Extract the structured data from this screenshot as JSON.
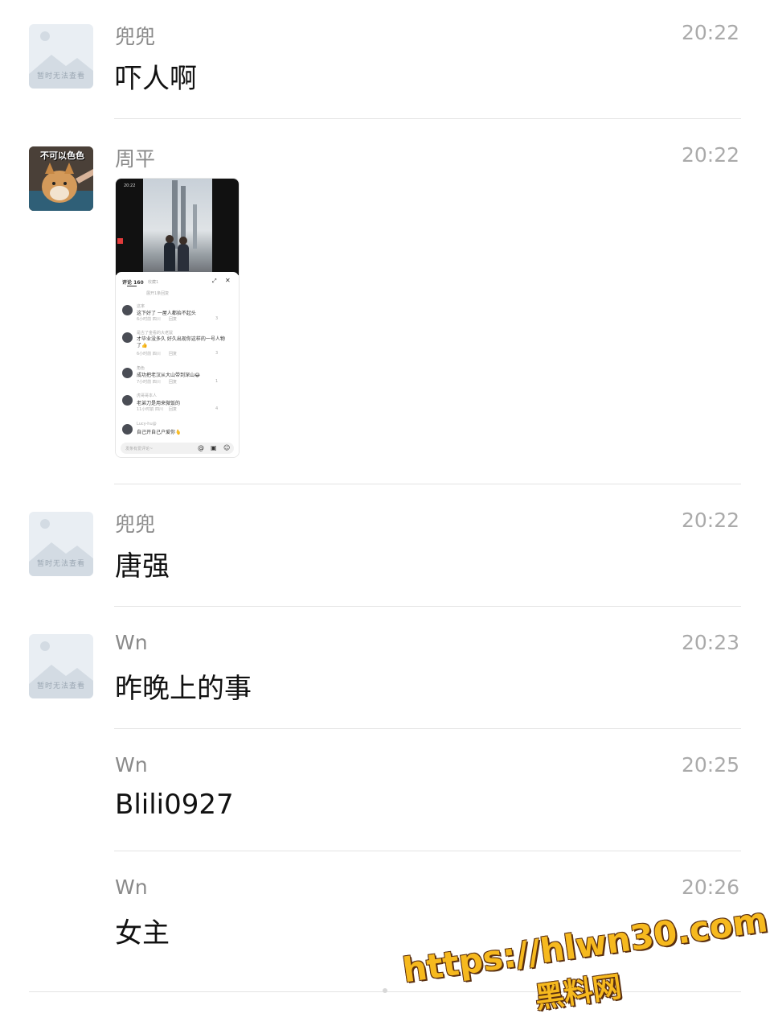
{
  "messages": [
    {
      "sender": "兜兜",
      "time": "20:22",
      "text": "吓人啊",
      "avatar_caption": "暂时无法查看"
    },
    {
      "sender": "周平",
      "time": "20:22",
      "avatar_caption": "不可以色色",
      "image": {
        "status_time": "20:22",
        "tabs": [
          "评论 160",
          "收藏1"
        ],
        "expand": "展开1条回复",
        "comments": [
          {
            "user": "这率",
            "text": "这下好了 一屋人都抬不起头",
            "meta": "6小时前 四川",
            "reply": "回复",
            "likes": "3"
          },
          {
            "user": "是古了金看的大老鼠",
            "text": "才毕业没多久 好久出现你这样的一号人物了👍",
            "meta": "6小时前 四川",
            "reply": "回复",
            "likes": "3"
          },
          {
            "user": "角色",
            "text": "成功把老汉从大山带到深山😂",
            "meta": "7小时前 四川",
            "reply": "回复",
            "likes": "1"
          },
          {
            "user": "虎哥哥本人",
            "text": "老弟刀是用来微饭的",
            "meta": "11小时前 四川",
            "reply": "回复",
            "likes": "4"
          },
          {
            "user": "Lucy-hu@",
            "text": "自己开自己户爱你🫰",
            "meta": "",
            "reply": "",
            "likes": ""
          }
        ],
        "input_placeholder": "发条有爱评论~"
      }
    },
    {
      "sender": "兜兜",
      "time": "20:22",
      "text": "唐强",
      "avatar_caption": "暂时无法查看"
    },
    {
      "sender": "Wn",
      "time": "20:23",
      "text": "昨晚上的事",
      "avatar_caption": "暂时无法查看"
    },
    {
      "sender": "Wn",
      "time": "20:25",
      "text": "Blili0927"
    },
    {
      "sender": "Wn",
      "time": "20:26",
      "text": "女主"
    }
  ],
  "watermark": {
    "line1": "https://hlwn30.com",
    "line2": "黑料网"
  },
  "colors": {
    "accent_watermark": "#f6b91e",
    "divider": "#e4e4e4",
    "time": "#aaaaaa"
  }
}
